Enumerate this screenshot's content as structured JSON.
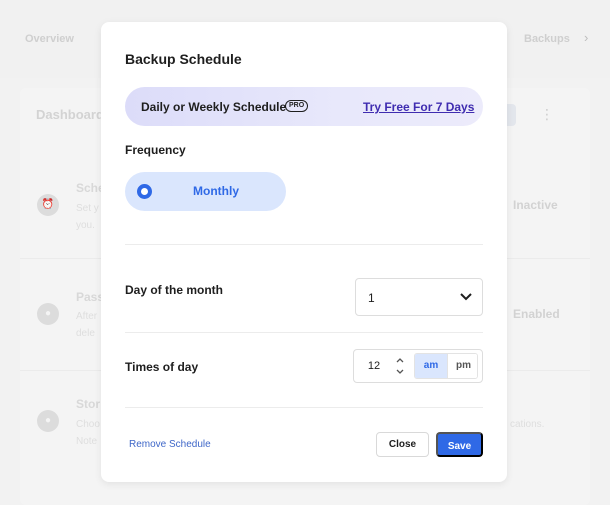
{
  "background": {
    "tabs": {
      "overview": "Overview",
      "backups": "Backups"
    },
    "title": "Dashboard",
    "rows": [
      {
        "icon": "alarm-icon",
        "title": "Sche",
        "text1": "Set y",
        "text2": "you.",
        "status": "Inactive"
      },
      {
        "icon": "lock-icon",
        "title": "Pass",
        "text1": "After",
        "text2": "dele",
        "status": "Enabled"
      },
      {
        "icon": "storage-icon",
        "title": "Stor",
        "text1": "Choo",
        "text2": "Note",
        "status": "cations."
      }
    ]
  },
  "modal": {
    "title": "Backup Schedule",
    "promo": {
      "label": "Daily or Weekly Schedule",
      "badge": "PRO",
      "link": "Try Free For 7 Days"
    },
    "frequency": {
      "label": "Frequency",
      "option": "Monthly"
    },
    "day_of_month": {
      "label": "Day of the month",
      "value": "1"
    },
    "times_of_day": {
      "label": "Times of day",
      "hour": "12",
      "am": "am",
      "pm": "pm",
      "selected": "am"
    },
    "footer": {
      "remove": "Remove Schedule",
      "close": "Close",
      "save": "Save"
    }
  },
  "colors": {
    "accent": "#2f69e6",
    "accent_soft": "#dae6fd",
    "promo_link": "#3f2cb0"
  }
}
